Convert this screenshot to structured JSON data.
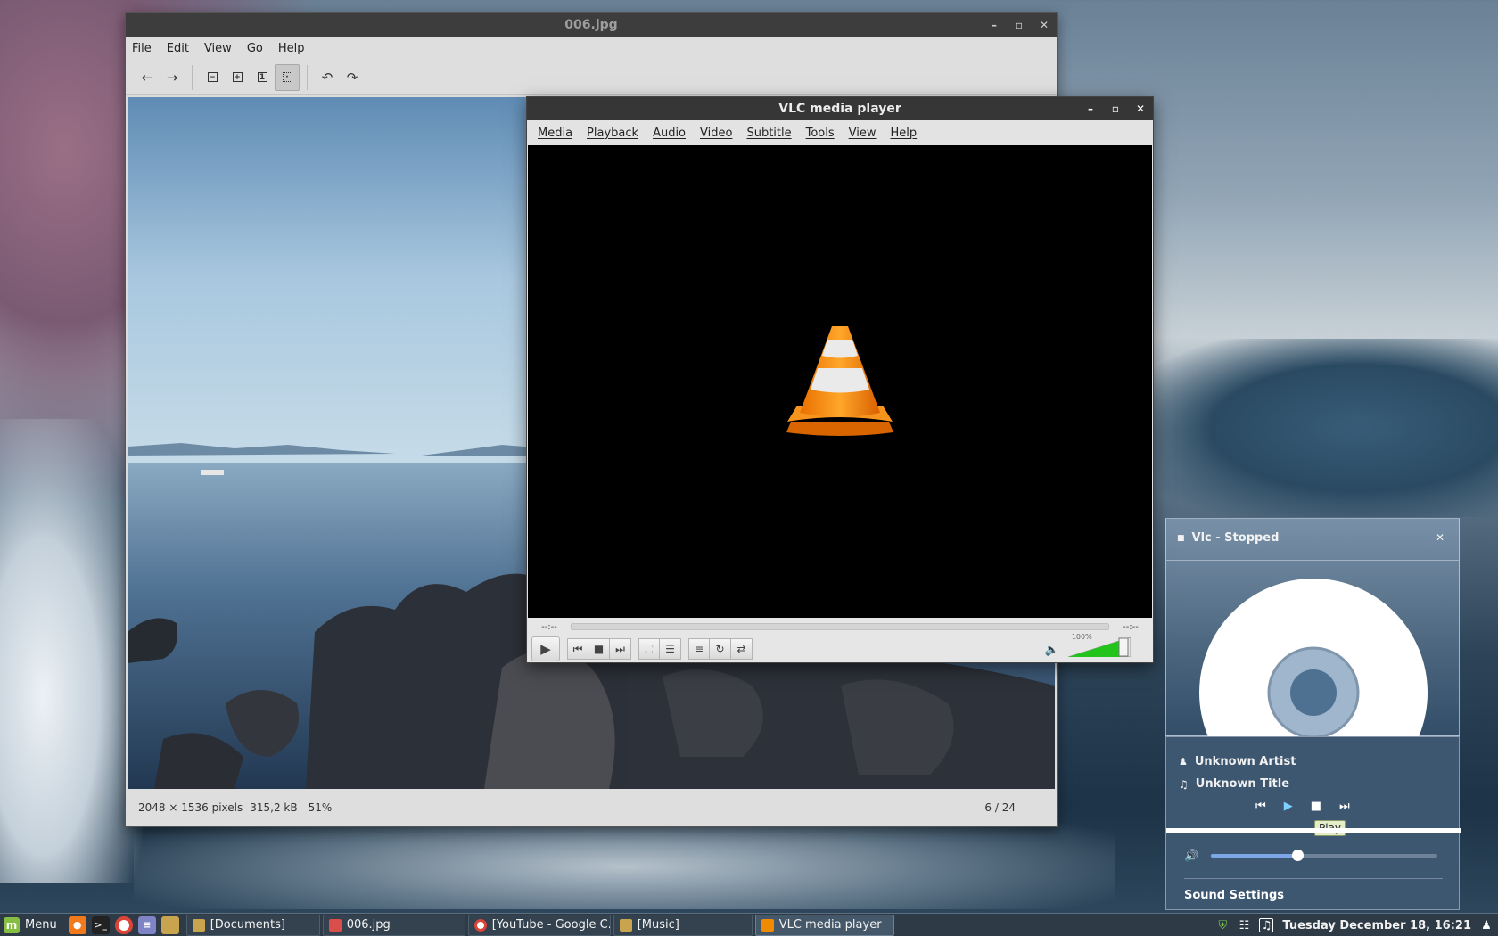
{
  "desktop": {},
  "viewer": {
    "title": "006.jpg",
    "menu": [
      "File",
      "Edit",
      "View",
      "Go",
      "Help"
    ],
    "toolbar": {
      "back": "back-arrow-icon",
      "forward": "forward-arrow-icon",
      "zoom_out": "zoom-out-icon",
      "zoom_in": "zoom-in-icon",
      "zoom_normal": "zoom-1-icon",
      "zoom_fit": "zoom-fit-icon",
      "rotate_left": "rotate-left-icon",
      "rotate_right": "rotate-right-icon"
    },
    "status": {
      "dimensions": "2048 × 1536 pixels",
      "size": "315,2 kB",
      "zoom": "51%",
      "page": "6 / 24"
    }
  },
  "vlc": {
    "title": "VLC media player",
    "menu": [
      "Media",
      "Playback",
      "Audio",
      "Video",
      "Subtitle",
      "Tools",
      "View",
      "Help"
    ],
    "elapsed": "--:--",
    "remaining": "--:--",
    "volume": "100%",
    "volume_fraction": 1.0,
    "accent": "#f08a00"
  },
  "applet": {
    "title": "Vlc - Stopped",
    "artist": "Unknown Artist",
    "track_title": "Unknown Title",
    "tooltip": "Play",
    "volume_fraction": 0.38,
    "settings": "Sound Settings"
  },
  "taskbar": {
    "menu_label": "Menu",
    "tasks": [
      {
        "label": "[Documents]",
        "icon": "folder-icon"
      },
      {
        "label": "006.jpg",
        "icon": "image-viewer-icon"
      },
      {
        "label": "[YouTube - Google C...",
        "icon": "chrome-icon"
      },
      {
        "label": "[Music]",
        "icon": "folder-icon"
      },
      {
        "label": "VLC media player",
        "icon": "vlc-icon"
      }
    ],
    "clock": "Tuesday December 18, 16:21"
  }
}
